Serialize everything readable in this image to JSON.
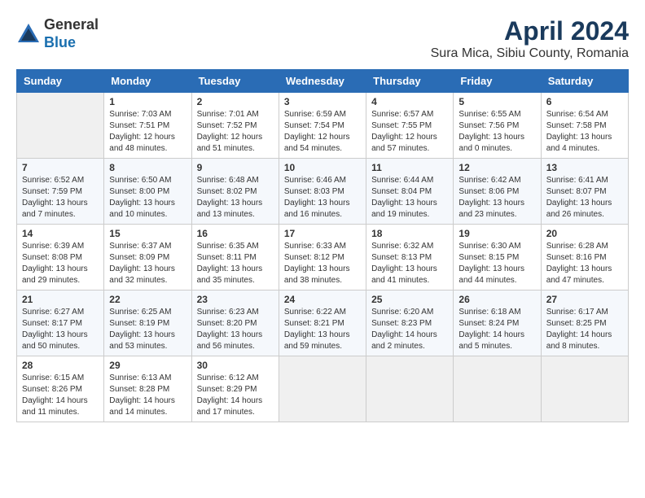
{
  "header": {
    "logo_line1": "General",
    "logo_line2": "Blue",
    "title": "April 2024",
    "subtitle": "Sura Mica, Sibiu County, Romania"
  },
  "days_of_week": [
    "Sunday",
    "Monday",
    "Tuesday",
    "Wednesday",
    "Thursday",
    "Friday",
    "Saturday"
  ],
  "weeks": [
    [
      {
        "day": "",
        "info": ""
      },
      {
        "day": "1",
        "info": "Sunrise: 7:03 AM\nSunset: 7:51 PM\nDaylight: 12 hours\nand 48 minutes."
      },
      {
        "day": "2",
        "info": "Sunrise: 7:01 AM\nSunset: 7:52 PM\nDaylight: 12 hours\nand 51 minutes."
      },
      {
        "day": "3",
        "info": "Sunrise: 6:59 AM\nSunset: 7:54 PM\nDaylight: 12 hours\nand 54 minutes."
      },
      {
        "day": "4",
        "info": "Sunrise: 6:57 AM\nSunset: 7:55 PM\nDaylight: 12 hours\nand 57 minutes."
      },
      {
        "day": "5",
        "info": "Sunrise: 6:55 AM\nSunset: 7:56 PM\nDaylight: 13 hours\nand 0 minutes."
      },
      {
        "day": "6",
        "info": "Sunrise: 6:54 AM\nSunset: 7:58 PM\nDaylight: 13 hours\nand 4 minutes."
      }
    ],
    [
      {
        "day": "7",
        "info": "Sunrise: 6:52 AM\nSunset: 7:59 PM\nDaylight: 13 hours\nand 7 minutes."
      },
      {
        "day": "8",
        "info": "Sunrise: 6:50 AM\nSunset: 8:00 PM\nDaylight: 13 hours\nand 10 minutes."
      },
      {
        "day": "9",
        "info": "Sunrise: 6:48 AM\nSunset: 8:02 PM\nDaylight: 13 hours\nand 13 minutes."
      },
      {
        "day": "10",
        "info": "Sunrise: 6:46 AM\nSunset: 8:03 PM\nDaylight: 13 hours\nand 16 minutes."
      },
      {
        "day": "11",
        "info": "Sunrise: 6:44 AM\nSunset: 8:04 PM\nDaylight: 13 hours\nand 19 minutes."
      },
      {
        "day": "12",
        "info": "Sunrise: 6:42 AM\nSunset: 8:06 PM\nDaylight: 13 hours\nand 23 minutes."
      },
      {
        "day": "13",
        "info": "Sunrise: 6:41 AM\nSunset: 8:07 PM\nDaylight: 13 hours\nand 26 minutes."
      }
    ],
    [
      {
        "day": "14",
        "info": "Sunrise: 6:39 AM\nSunset: 8:08 PM\nDaylight: 13 hours\nand 29 minutes."
      },
      {
        "day": "15",
        "info": "Sunrise: 6:37 AM\nSunset: 8:09 PM\nDaylight: 13 hours\nand 32 minutes."
      },
      {
        "day": "16",
        "info": "Sunrise: 6:35 AM\nSunset: 8:11 PM\nDaylight: 13 hours\nand 35 minutes."
      },
      {
        "day": "17",
        "info": "Sunrise: 6:33 AM\nSunset: 8:12 PM\nDaylight: 13 hours\nand 38 minutes."
      },
      {
        "day": "18",
        "info": "Sunrise: 6:32 AM\nSunset: 8:13 PM\nDaylight: 13 hours\nand 41 minutes."
      },
      {
        "day": "19",
        "info": "Sunrise: 6:30 AM\nSunset: 8:15 PM\nDaylight: 13 hours\nand 44 minutes."
      },
      {
        "day": "20",
        "info": "Sunrise: 6:28 AM\nSunset: 8:16 PM\nDaylight: 13 hours\nand 47 minutes."
      }
    ],
    [
      {
        "day": "21",
        "info": "Sunrise: 6:27 AM\nSunset: 8:17 PM\nDaylight: 13 hours\nand 50 minutes."
      },
      {
        "day": "22",
        "info": "Sunrise: 6:25 AM\nSunset: 8:19 PM\nDaylight: 13 hours\nand 53 minutes."
      },
      {
        "day": "23",
        "info": "Sunrise: 6:23 AM\nSunset: 8:20 PM\nDaylight: 13 hours\nand 56 minutes."
      },
      {
        "day": "24",
        "info": "Sunrise: 6:22 AM\nSunset: 8:21 PM\nDaylight: 13 hours\nand 59 minutes."
      },
      {
        "day": "25",
        "info": "Sunrise: 6:20 AM\nSunset: 8:23 PM\nDaylight: 14 hours\nand 2 minutes."
      },
      {
        "day": "26",
        "info": "Sunrise: 6:18 AM\nSunset: 8:24 PM\nDaylight: 14 hours\nand 5 minutes."
      },
      {
        "day": "27",
        "info": "Sunrise: 6:17 AM\nSunset: 8:25 PM\nDaylight: 14 hours\nand 8 minutes."
      }
    ],
    [
      {
        "day": "28",
        "info": "Sunrise: 6:15 AM\nSunset: 8:26 PM\nDaylight: 14 hours\nand 11 minutes."
      },
      {
        "day": "29",
        "info": "Sunrise: 6:13 AM\nSunset: 8:28 PM\nDaylight: 14 hours\nand 14 minutes."
      },
      {
        "day": "30",
        "info": "Sunrise: 6:12 AM\nSunset: 8:29 PM\nDaylight: 14 hours\nand 17 minutes."
      },
      {
        "day": "",
        "info": ""
      },
      {
        "day": "",
        "info": ""
      },
      {
        "day": "",
        "info": ""
      },
      {
        "day": "",
        "info": ""
      }
    ]
  ]
}
